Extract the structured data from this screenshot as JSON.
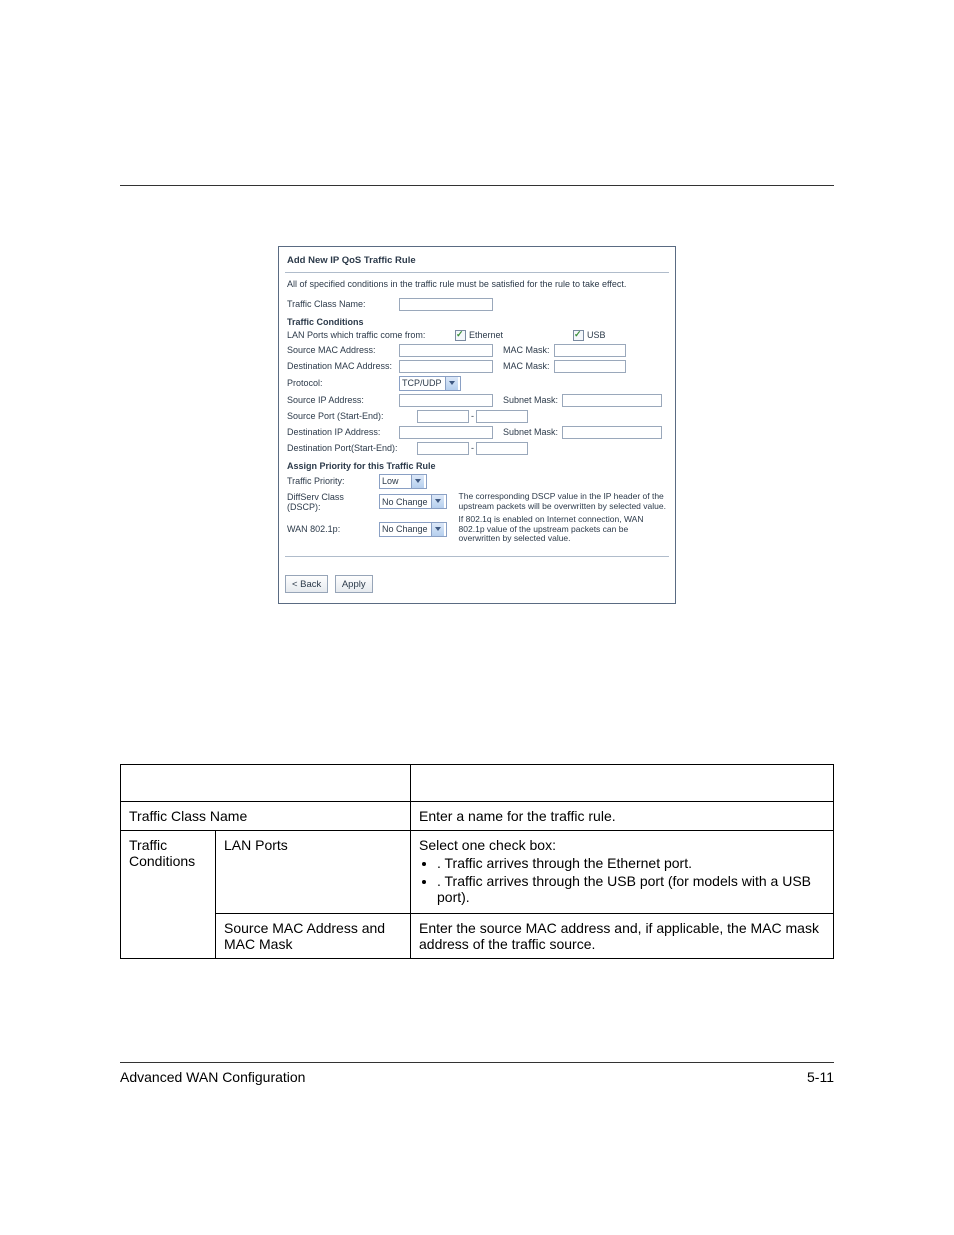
{
  "panel": {
    "title": "Add New IP QoS Traffic Rule",
    "intro": "All of specified conditions in the traffic rule must be satisfied for the rule to take effect.",
    "traffic_class_name_label": "Traffic Class Name:",
    "conditions_heading": "Traffic Conditions",
    "lan_ports_label": "LAN Ports which traffic come from:",
    "chk_ethernet": "Ethernet",
    "chk_usb": "USB",
    "src_mac_label": "Source MAC Address:",
    "mac_mask_label": "MAC Mask:",
    "dst_mac_label": "Destination MAC Address:",
    "protocol_label": "Protocol:",
    "protocol_value": "TCP/UDP",
    "src_ip_label": "Source IP Address:",
    "subnet_mask_label": "Subnet Mask:",
    "src_port_label": "Source Port (Start-End):",
    "dst_ip_label": "Destination IP Address:",
    "dst_port_label": "Destination Port(Start-End):",
    "priority_heading": "Assign Priority for this Traffic Rule",
    "priority_label": "Traffic Priority:",
    "priority_value": "Low",
    "dscp_label": "DiffServ Class (DSCP):",
    "dscp_value": "No Change",
    "dscp_desc": "The corresponding DSCP value in the IP header of the upstream packets will be overwritten by selected value.",
    "wan_label": "WAN 802.1p:",
    "wan_value": "No Change",
    "wan_desc": "If 802.1q is enabled on Internet connection, WAN 802.1p value of the upstream packets can be overwritten by selected value.",
    "back_btn": "< Back",
    "apply_btn": "Apply"
  },
  "doc": {
    "row1_field": "Traffic Class Name",
    "row1_desc": "Enter a name for the traffic rule.",
    "row2_group": "Traffic Conditions",
    "row2_field": "LAN Ports",
    "row2_line1": "Select one check box:",
    "row2_bullet1_term": "",
    "row2_bullet1_text": ". Traffic arrives through the Ethernet port.",
    "row2_bullet2_term": "",
    "row2_bullet2_text": ". Traffic arrives through the USB port (for models with a USB port).",
    "row3_field": "Source MAC Address and MAC Mask",
    "row3_desc": "Enter the source MAC address and, if applicable, the MAC mask address of the traffic source."
  },
  "footer": {
    "left": "Advanced WAN Configuration",
    "right": "5-11"
  }
}
